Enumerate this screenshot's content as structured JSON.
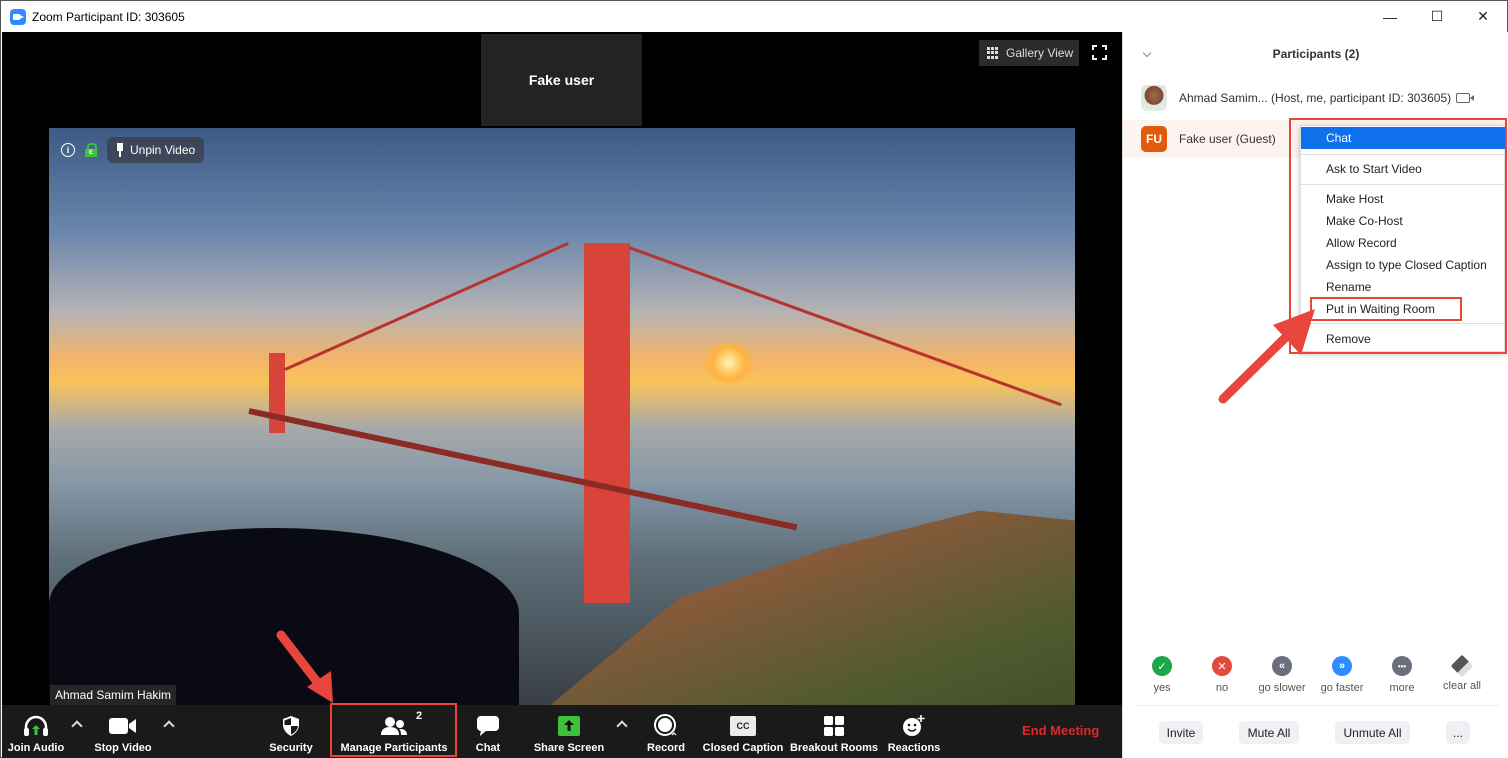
{
  "window": {
    "title": "Zoom Participant ID: 303605",
    "controls": {
      "minimize": "—",
      "maximize": "☐",
      "close": "✕"
    }
  },
  "meeting": {
    "thumbnail_name": "Fake user",
    "gallery_view_label": "Gallery View",
    "unpin_label": "Unpin Video",
    "info_glyph": "i",
    "speaker_name": "Ahmad Samim Hakim"
  },
  "toolbar": {
    "join_audio": "Join Audio",
    "stop_video": "Stop Video",
    "security": "Security",
    "manage_participants": "Manage Participants",
    "participant_count": "2",
    "chat": "Chat",
    "share_screen": "Share Screen",
    "record": "Record",
    "closed_caption": "Closed Caption",
    "cc_glyph": "CC",
    "breakout_rooms": "Breakout Rooms",
    "reactions": "Reactions",
    "end_meeting": "End Meeting"
  },
  "panel": {
    "title": "Participants (2)",
    "participants": [
      {
        "name": "Ahmad Samim... (Host, me, participant ID: 303605)",
        "avatar": "photo"
      },
      {
        "name": "Fake user (Guest)",
        "initials": "FU"
      }
    ],
    "context_menu": {
      "items": [
        {
          "label": "Chat",
          "active": true
        },
        {
          "label": "Ask to Start Video"
        },
        {
          "label": "Make Host"
        },
        {
          "label": "Make Co-Host"
        },
        {
          "label": "Allow Record"
        },
        {
          "label": "Assign to type Closed Caption"
        },
        {
          "label": "Rename"
        },
        {
          "label": "Put in Waiting Room",
          "highlighted": true
        },
        {
          "label": "Remove"
        }
      ]
    },
    "nonverbal": [
      {
        "label": "yes",
        "glyph": "✓",
        "color": "#1ea64a"
      },
      {
        "label": "no",
        "glyph": "✕",
        "color": "#e34a3c"
      },
      {
        "label": "go slower",
        "glyph": "«",
        "color": "#6b6e7c"
      },
      {
        "label": "go faster",
        "glyph": "»",
        "color": "#2d8cff"
      },
      {
        "label": "more",
        "glyph": "•••",
        "color": "#6b6e7c"
      },
      {
        "label": "clear all",
        "glyph": "",
        "color": "#555555"
      }
    ],
    "buttons": {
      "invite": "Invite",
      "mute_all": "Mute All",
      "unmute_all": "Unmute All",
      "more": "..."
    }
  },
  "colors": {
    "annotation_red": "#e8453c",
    "menu_active": "#0e71eb",
    "end_meeting": "#e02828"
  }
}
